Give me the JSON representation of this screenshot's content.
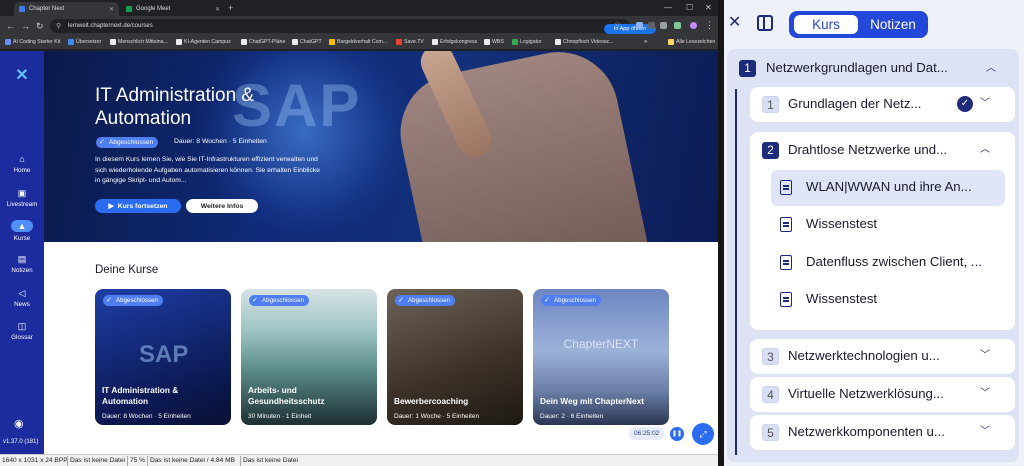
{
  "browser": {
    "tabs": [
      {
        "label": "Chapter Next",
        "active": true
      },
      {
        "label": "Google Meet",
        "active": false
      }
    ],
    "url": "lernwelt.chapternext.de/courses",
    "in_app_label": "In App öffnen",
    "bookmarks": [
      "AI Coding Starter Kit",
      "Übersetzer",
      "Menschlich Mitteina...",
      "KI-Agenten Campus",
      "ChatGPT-Pläne",
      "ChatGPT",
      "Bargeldverhalt Com...",
      "Save.TV",
      "Erfolgskongress",
      "WBS",
      "Logigator",
      "Chnopfloch Videoac..."
    ],
    "all_bookmarks": "Alle Lesezeichen"
  },
  "nav": {
    "items": [
      {
        "label": "Home",
        "icon": "home-icon"
      },
      {
        "label": "Livestream",
        "icon": "livestream-icon"
      },
      {
        "label": "Kurse",
        "icon": "courses-icon",
        "active": true
      },
      {
        "label": "Notizen",
        "icon": "notes-icon"
      },
      {
        "label": "News",
        "icon": "news-icon"
      },
      {
        "label": "Glossar",
        "icon": "glossary-icon"
      }
    ],
    "version": "v1.37.0 (181)"
  },
  "hero": {
    "title": "IT Administration & Automation",
    "badge": "Abgeschlossen",
    "duration": "Dauer: 8 Wochen · 5 Einheiten",
    "description": "In diesem Kurs lernen Sie, wie Sie IT-Infrastrukturen effizient verwalten und sich wiederholende Aufgaben automatisieren können. Sie erhalten Einblicke in gängige Skript- und Autom...",
    "continue_label": "Kurs fortsetzen",
    "more_label": "Weitere Infos"
  },
  "courses": {
    "heading": "Deine Kurse",
    "items": [
      {
        "badge": "Abgeschlossen",
        "title": "IT Administration & Automation",
        "duration": "Dauer: 8 Wochen · 5 Einheiten"
      },
      {
        "badge": "Abgeschlossen",
        "title": "Arbeits- und Gesundheitsschutz",
        "duration": "30 Minuten · 1 Einheit"
      },
      {
        "badge": "Abgeschlossen",
        "title": "Bewerbercoaching",
        "duration": "Dauer: 1 Woche · 5 Einheiten"
      },
      {
        "badge": "Abgeschlossen",
        "title": "Dein Weg mit ChapterNext",
        "duration": "Dauer: 2 · 6 Einheiten"
      }
    ]
  },
  "player": {
    "time": "06:25:02"
  },
  "statusbar": [
    "1640 x 1031 x 24 BPP",
    "Das ist keine Datei",
    "75 %",
    "Das ist keine Datei / 4.84 MB",
    "Das ist keine Datei"
  ],
  "panel": {
    "tab_course": "Kurs",
    "tab_notes": "Notizen",
    "chapter": {
      "number": "1",
      "title": "Netzwerkgrundlagen und Dat..."
    },
    "modules": [
      {
        "number": "1",
        "title": "Grundlagen der Netz...",
        "completed": true
      },
      {
        "number": "2",
        "title": "Drahtlose Netzwerke und...",
        "expanded": true,
        "lessons": [
          {
            "title": "WLAN|WWAN und ihre An...",
            "icon": "document-icon",
            "selected": true
          },
          {
            "title": "Wissenstest",
            "icon": "quiz-icon"
          },
          {
            "title": "Datenfluss zwischen Client, ...",
            "icon": "document-icon"
          },
          {
            "title": "Wissenstest",
            "icon": "quiz-icon"
          }
        ]
      },
      {
        "number": "3",
        "title": "Netzwerktechnologien u..."
      },
      {
        "number": "4",
        "title": "Virtuelle Netzwerklösung..."
      },
      {
        "number": "5",
        "title": "Netzwerkkomponenten u..."
      }
    ]
  }
}
